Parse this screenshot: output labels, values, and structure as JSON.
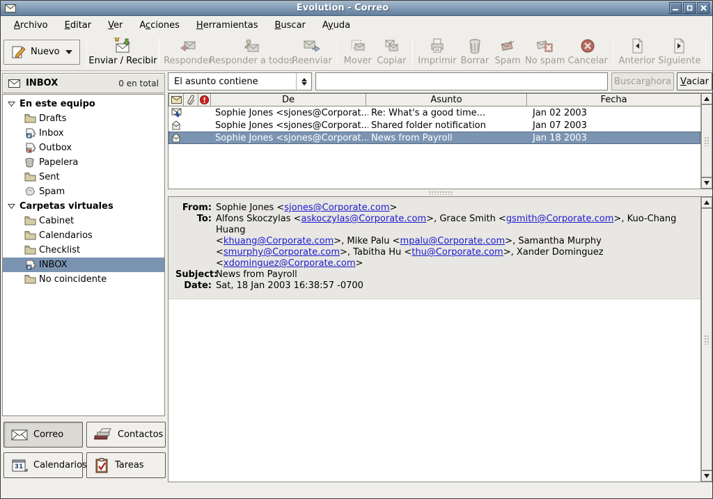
{
  "window": {
    "title": "Evolution - Correo"
  },
  "menu": {
    "items": [
      {
        "pre": "",
        "key": "A",
        "post": "rchivo"
      },
      {
        "pre": "",
        "key": "E",
        "post": "ditar"
      },
      {
        "pre": "",
        "key": "V",
        "post": "er"
      },
      {
        "pre": "A",
        "key": "c",
        "post": "ciones"
      },
      {
        "pre": "",
        "key": "H",
        "post": "erramientas"
      },
      {
        "pre": "",
        "key": "B",
        "post": "uscar"
      },
      {
        "pre": "A",
        "key": "y",
        "post": "uda"
      }
    ]
  },
  "toolbar": {
    "new_label": "Nuevo",
    "items": [
      {
        "type": "sep"
      },
      {
        "label": "Enviar / Recibir",
        "icon": "send-receive",
        "enabled": true
      },
      {
        "type": "sep"
      },
      {
        "label": "Responder",
        "icon": "reply",
        "enabled": false
      },
      {
        "label": "Responder a todos",
        "icon": "reply-all",
        "enabled": false
      },
      {
        "label": "Reenviar",
        "icon": "forward",
        "enabled": false
      },
      {
        "type": "sep"
      },
      {
        "label": "Mover",
        "icon": "move",
        "enabled": false
      },
      {
        "label": "Copiar",
        "icon": "copy",
        "enabled": false
      },
      {
        "type": "sep"
      },
      {
        "label": "Imprimir",
        "icon": "print",
        "enabled": false
      },
      {
        "label": "Borrar",
        "icon": "delete",
        "enabled": false
      },
      {
        "label": "Spam",
        "icon": "spam",
        "enabled": false
      },
      {
        "label": "No spam",
        "icon": "no-spam",
        "enabled": false
      },
      {
        "label": "Cancelar",
        "icon": "cancel",
        "enabled": false
      },
      {
        "type": "sep"
      },
      {
        "label": "Anterior",
        "icon": "previous",
        "enabled": false
      },
      {
        "label": "Siguiente",
        "icon": "next",
        "enabled": false
      },
      {
        "type": "sep"
      }
    ]
  },
  "search": {
    "filter_value": "El asunto contiene",
    "query_value": "",
    "search_button": {
      "pre": "Buscar ",
      "key": "a",
      "post": "hora",
      "enabled": false
    },
    "clear_button": {
      "pre": "",
      "key": "V",
      "post": "aciar",
      "enabled": true
    }
  },
  "sidebar": {
    "header": {
      "title": "INBOX",
      "count": "0 en total"
    },
    "groups": [
      {
        "label": "En este equipo",
        "items": [
          {
            "label": "Drafts",
            "icon": "folder"
          },
          {
            "label": "Inbox",
            "icon": "inbox"
          },
          {
            "label": "Outbox",
            "icon": "outbox"
          },
          {
            "label": "Papelera",
            "icon": "trash"
          },
          {
            "label": "Sent",
            "icon": "folder"
          },
          {
            "label": "Spam",
            "icon": "junk"
          }
        ]
      },
      {
        "label": "Carpetas virtuales",
        "items": [
          {
            "label": "Cabinet",
            "icon": "folder"
          },
          {
            "label": "Calendarios",
            "icon": "folder"
          },
          {
            "label": "Checklist",
            "icon": "folder"
          },
          {
            "label": "INBOX",
            "icon": "inbox",
            "selected": true
          },
          {
            "label": "No coincidente",
            "icon": "folder"
          }
        ]
      }
    ]
  },
  "switcher": {
    "buttons": [
      {
        "label": "Correo",
        "icon": "mail",
        "active": true
      },
      {
        "label": "Contactos",
        "icon": "contacts",
        "active": false
      },
      {
        "label": "Calendarios",
        "icon": "calendar",
        "active": false
      },
      {
        "label": "Tareas",
        "icon": "tasks",
        "active": false
      }
    ]
  },
  "message_list": {
    "icon_columns": [
      "mail-status",
      "attachment",
      "importance"
    ],
    "columns": [
      "De",
      "Asunto",
      "Fecha"
    ],
    "rows": [
      {
        "status": "mail-replied",
        "from": "Sophie Jones <sjones@Corporat...",
        "subject": "Re: What's a good time...",
        "date": "Jan 02 2003",
        "selected": false
      },
      {
        "status": "mail-open",
        "from": "Sophie Jones <sjones@Corporat...",
        "subject": "Shared folder notification",
        "date": "Jan 07 2003",
        "selected": false
      },
      {
        "status": "mail-open",
        "from": "Sophie Jones <sjones@Corporat...",
        "subject": "News from Payroll",
        "date": "Jan 18 2003",
        "selected": true
      }
    ]
  },
  "preview": {
    "from_label": "From:",
    "from_segments": [
      {
        "t": "Sophie Jones <"
      },
      {
        "t": "sjones@Corporate.com",
        "link": true
      },
      {
        "t": ">"
      }
    ],
    "to_label": "To:",
    "to_lines": [
      [
        {
          "t": "Alfons Skoczylas <"
        },
        {
          "t": "askoczylas@Corporate.com",
          "link": true
        },
        {
          "t": ">, Grace Smith <"
        },
        {
          "t": "gsmith@Corporate.com",
          "link": true
        },
        {
          "t": ">, Kuo-Chang Huang"
        }
      ],
      [
        {
          "t": "<"
        },
        {
          "t": "khuang@Corporate.com",
          "link": true
        },
        {
          "t": ">, Mike Palu <"
        },
        {
          "t": "mpalu@Corporate.com",
          "link": true
        },
        {
          "t": ">, Samantha Murphy"
        }
      ],
      [
        {
          "t": "<"
        },
        {
          "t": "smurphy@Corporate.com",
          "link": true
        },
        {
          "t": ">, Tabitha Hu <"
        },
        {
          "t": "thu@Corporate.com",
          "link": true
        },
        {
          "t": ">, Xander Dominguez"
        }
      ],
      [
        {
          "t": "<"
        },
        {
          "t": "xdominguez@Corporate.com",
          "link": true
        },
        {
          "t": ">"
        }
      ]
    ],
    "subject_label": "Subject:",
    "subject": "News from Payroll",
    "date_label": "Date:",
    "date": "Sat, 18 Jan 2003 16:38:57 -0700"
  },
  "colors": {
    "selection": "#7b94b2",
    "titlebar_top": "#a9bbcd",
    "titlebar_bottom": "#637e9b",
    "chrome": "#efeeea",
    "link": "#1a1acd",
    "importance_red": "#cc2222"
  }
}
